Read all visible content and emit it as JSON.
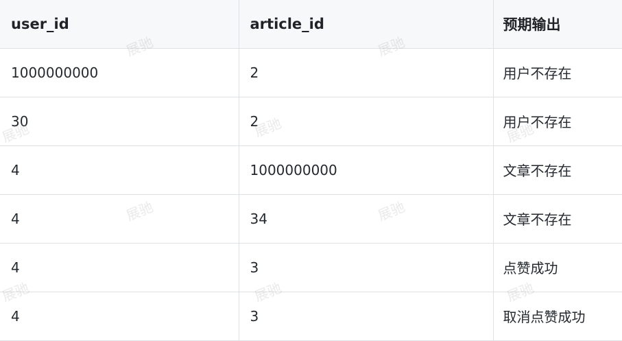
{
  "table": {
    "headers": [
      "user_id",
      "article_id",
      "预期输出"
    ],
    "rows": [
      [
        "1000000000",
        "2",
        "用户不存在"
      ],
      [
        "30",
        "2",
        "用户不存在"
      ],
      [
        "4",
        "1000000000",
        "文章不存在"
      ],
      [
        "4",
        "34",
        "文章不存在"
      ],
      [
        "4",
        "3",
        "点赞成功"
      ],
      [
        "4",
        "3",
        "取消点赞成功"
      ]
    ]
  },
  "watermark": {
    "text": "展驰",
    "color": "#a0a0a0"
  }
}
